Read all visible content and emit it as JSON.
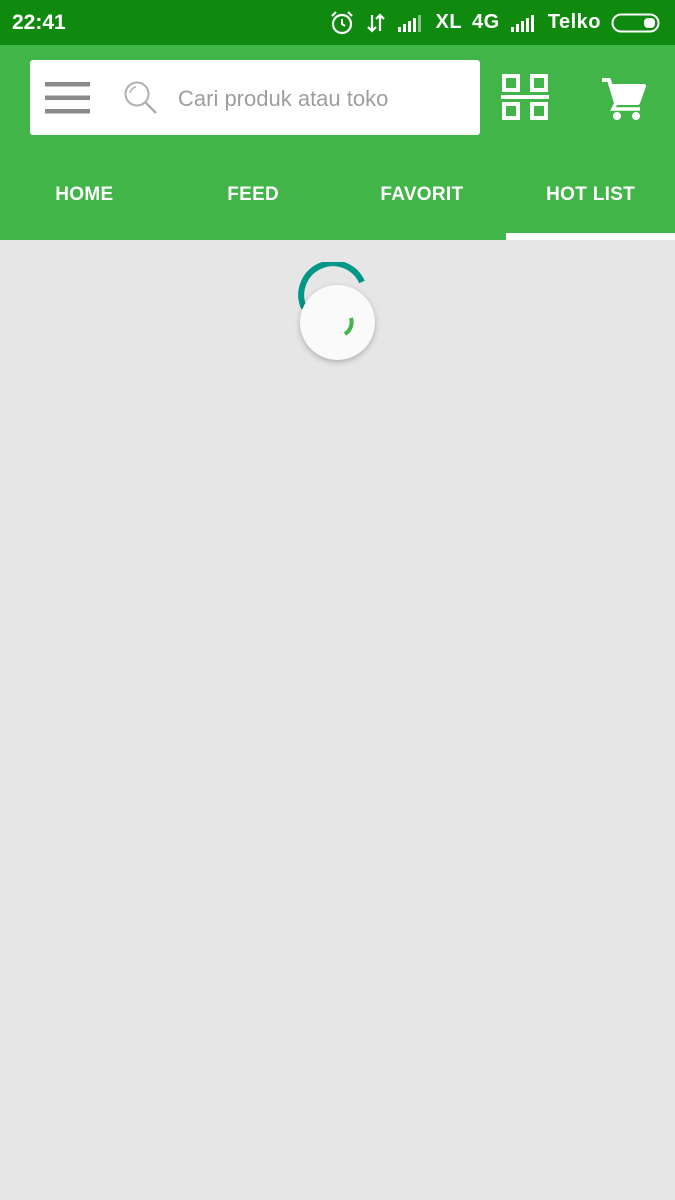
{
  "status_bar": {
    "time": "22:41",
    "carrier1": "XL",
    "network": "4G",
    "carrier2": "Telko",
    "icons": [
      "alarm-icon",
      "data-transfer-icon",
      "signal-icon",
      "signal-icon",
      "battery-icon"
    ]
  },
  "header": {
    "search_placeholder": "Cari produk atau toko",
    "icons": [
      "menu-icon",
      "search-icon",
      "qr-code-icon",
      "cart-icon"
    ]
  },
  "tabs": [
    {
      "label": "HOME",
      "active": false
    },
    {
      "label": "FEED",
      "active": false
    },
    {
      "label": "FAVORIT",
      "active": false
    },
    {
      "label": "HOT LIST",
      "active": true
    }
  ],
  "colors": {
    "status_bar": "#0f8a0f",
    "app_bar": "#42b549",
    "background": "#e6e6e6",
    "spinner_teal": "#009688",
    "spinner_green": "#42b549"
  }
}
